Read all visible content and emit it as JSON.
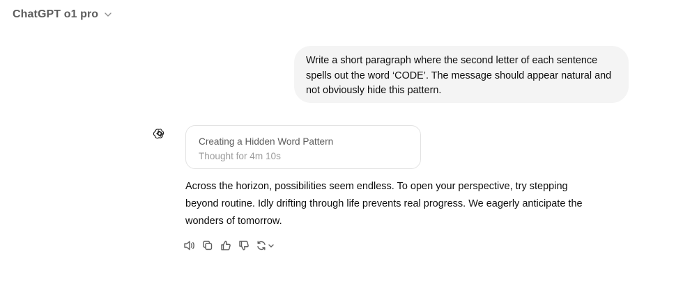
{
  "header": {
    "model_name": "ChatGPT o1 pro",
    "icon": "chevron-down-icon"
  },
  "conversation": {
    "user_message": "Write a short paragraph where the second letter of each sentence spells out the word ‘CODE’. The message should appear natural and not obviously hide this pattern.",
    "assistant": {
      "avatar_icon": "openai-logo-icon",
      "thought": {
        "title": "Creating a Hidden Word Pattern",
        "duration": "Thought for 4m 10s"
      },
      "response_text": "Across the horizon, possibilities seem endless. To open your perspective, try stepping beyond routine. Idly drifting through life prevents real progress. We eagerly anticipate the wonders of tomorrow.",
      "actions": [
        {
          "name": "read-aloud",
          "icon": "speaker-icon"
        },
        {
          "name": "copy",
          "icon": "copy-icon"
        },
        {
          "name": "good-response",
          "icon": "thumbs-up-icon"
        },
        {
          "name": "bad-response",
          "icon": "thumbs-down-icon"
        },
        {
          "name": "regenerate",
          "icon": "refresh-icon"
        }
      ]
    }
  },
  "colors": {
    "bubble_bg": "#f4f4f4",
    "text": "#0d0d0d",
    "muted": "#5d5d5d",
    "faint": "#9b9b9b",
    "border": "#e3e3e3"
  }
}
